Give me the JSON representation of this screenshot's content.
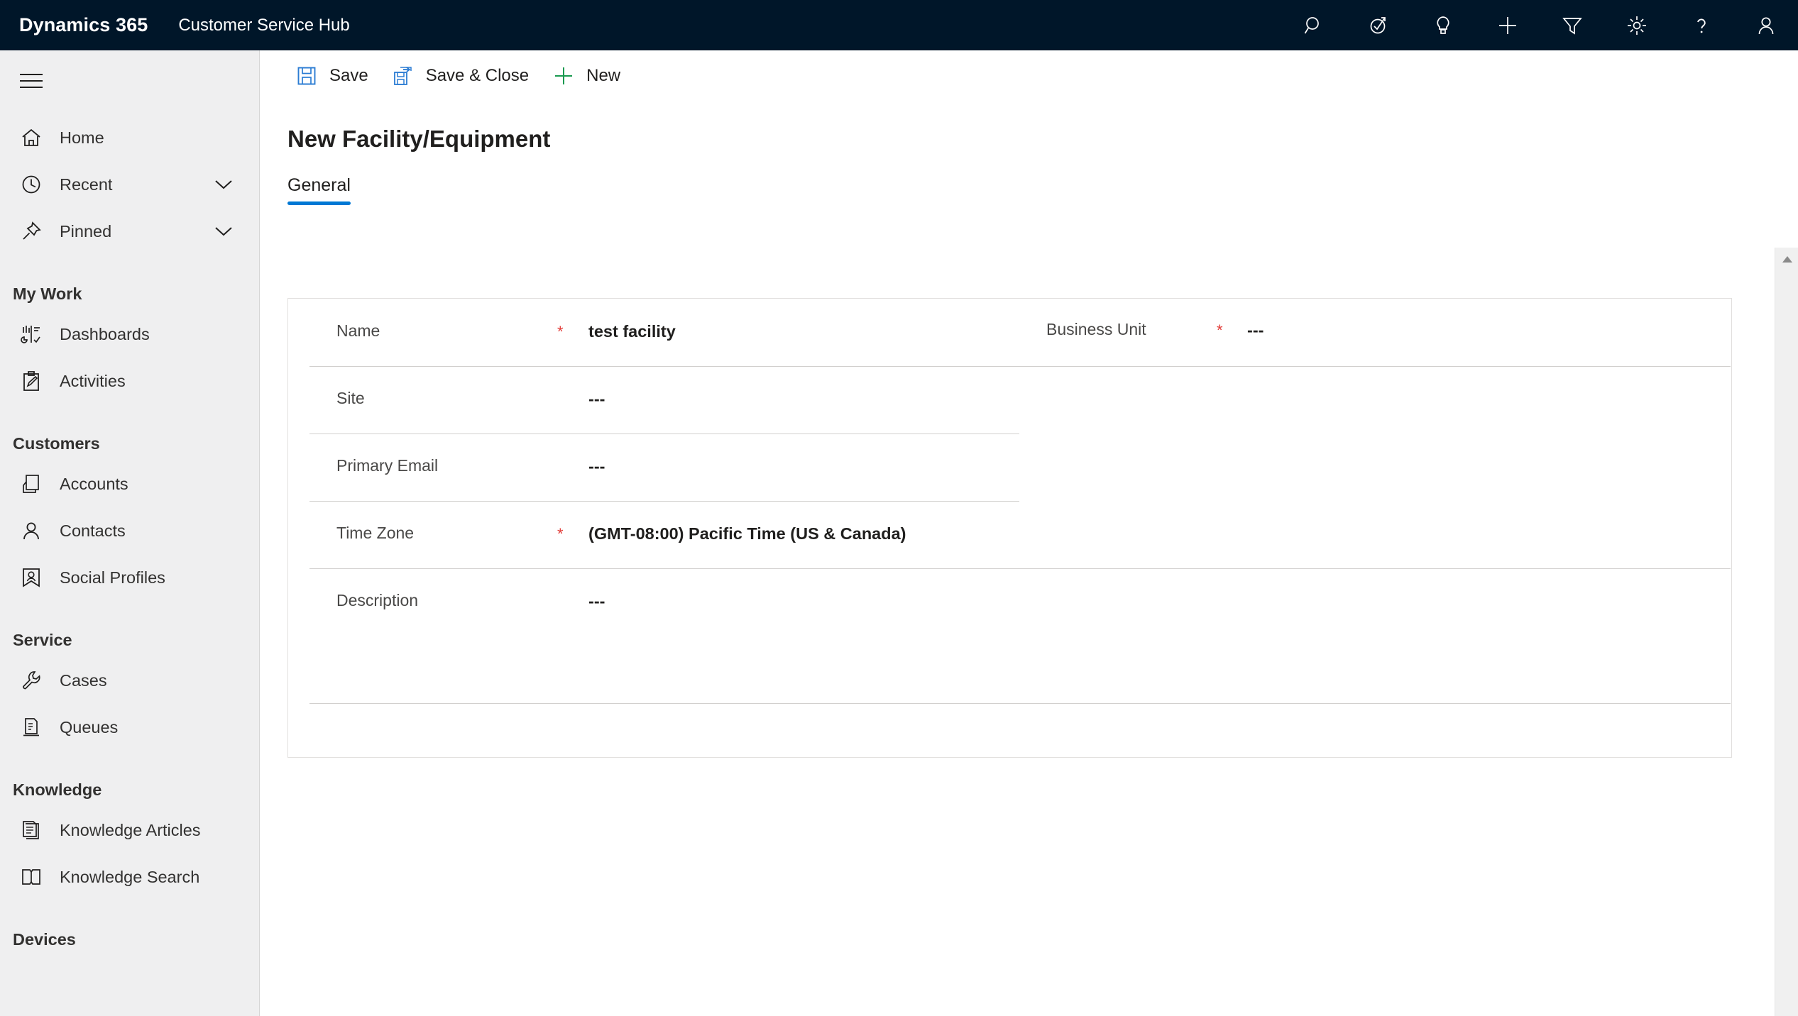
{
  "header": {
    "brand": "Dynamics 365",
    "app_name": "Customer Service Hub",
    "bg_color": "#001629",
    "icons": [
      {
        "name": "search-icon",
        "label": "Search"
      },
      {
        "name": "assistant-check-icon",
        "label": "Assistant"
      },
      {
        "name": "lightbulb-icon",
        "label": "Insights"
      },
      {
        "name": "plus-icon",
        "label": "Quick Create"
      },
      {
        "name": "filter-icon",
        "label": "Filter"
      },
      {
        "name": "gear-icon",
        "label": "Settings"
      },
      {
        "name": "question-icon",
        "label": "Help"
      },
      {
        "name": "person-icon",
        "label": "User Profile"
      }
    ]
  },
  "sidebar": {
    "hamburger_label": "Site Map",
    "items": [
      {
        "label": "Home",
        "icon": "home-icon",
        "chevron": false
      },
      {
        "label": "Recent",
        "icon": "clock-icon",
        "chevron": true
      },
      {
        "label": "Pinned",
        "icon": "pin-icon",
        "chevron": true
      }
    ],
    "groups": [
      {
        "title": "My Work",
        "items": [
          {
            "label": "Dashboards",
            "icon": "dashboard-icon"
          },
          {
            "label": "Activities",
            "icon": "activities-icon"
          }
        ]
      },
      {
        "title": "Customers",
        "items": [
          {
            "label": "Accounts",
            "icon": "accounts-icon"
          },
          {
            "label": "Contacts",
            "icon": "contact-icon"
          },
          {
            "label": "Social Profiles",
            "icon": "social-profile-icon"
          }
        ]
      },
      {
        "title": "Service",
        "items": [
          {
            "label": "Cases",
            "icon": "wrench-icon"
          },
          {
            "label": "Queues",
            "icon": "queue-icon"
          }
        ]
      },
      {
        "title": "Knowledge",
        "items": [
          {
            "label": "Knowledge Articles",
            "icon": "article-icon"
          },
          {
            "label": "Knowledge Search",
            "icon": "book-icon"
          }
        ]
      }
    ],
    "clipped_group_title": "Devices"
  },
  "commandbar": {
    "buttons": [
      {
        "label": "Save",
        "icon": "save-icon",
        "color": "#2b7cd3"
      },
      {
        "label": "Save & Close",
        "icon": "save-close-icon",
        "color": "#2b7cd3"
      },
      {
        "label": "New",
        "icon": "plus-icon",
        "color": "#1a9a50"
      }
    ]
  },
  "main": {
    "page_title": "New Facility/Equipment",
    "tabs": [
      {
        "label": "General",
        "active": true
      }
    ],
    "accent_color": "#0078d4",
    "required_marker": "*",
    "empty_value": "---",
    "fields_left": [
      {
        "label": "Name",
        "value": "test facility",
        "required": true
      },
      {
        "label": "Site",
        "value": "---",
        "required": false
      },
      {
        "label": "Primary Email",
        "value": "---",
        "required": false
      },
      {
        "label": "Time Zone",
        "value": "(GMT-08:00) Pacific Time (US & Canada)",
        "required": true
      },
      {
        "label": "Description",
        "value": "---",
        "required": false
      }
    ],
    "fields_right": [
      {
        "label": "Business Unit",
        "value": "---",
        "required": true
      }
    ]
  }
}
